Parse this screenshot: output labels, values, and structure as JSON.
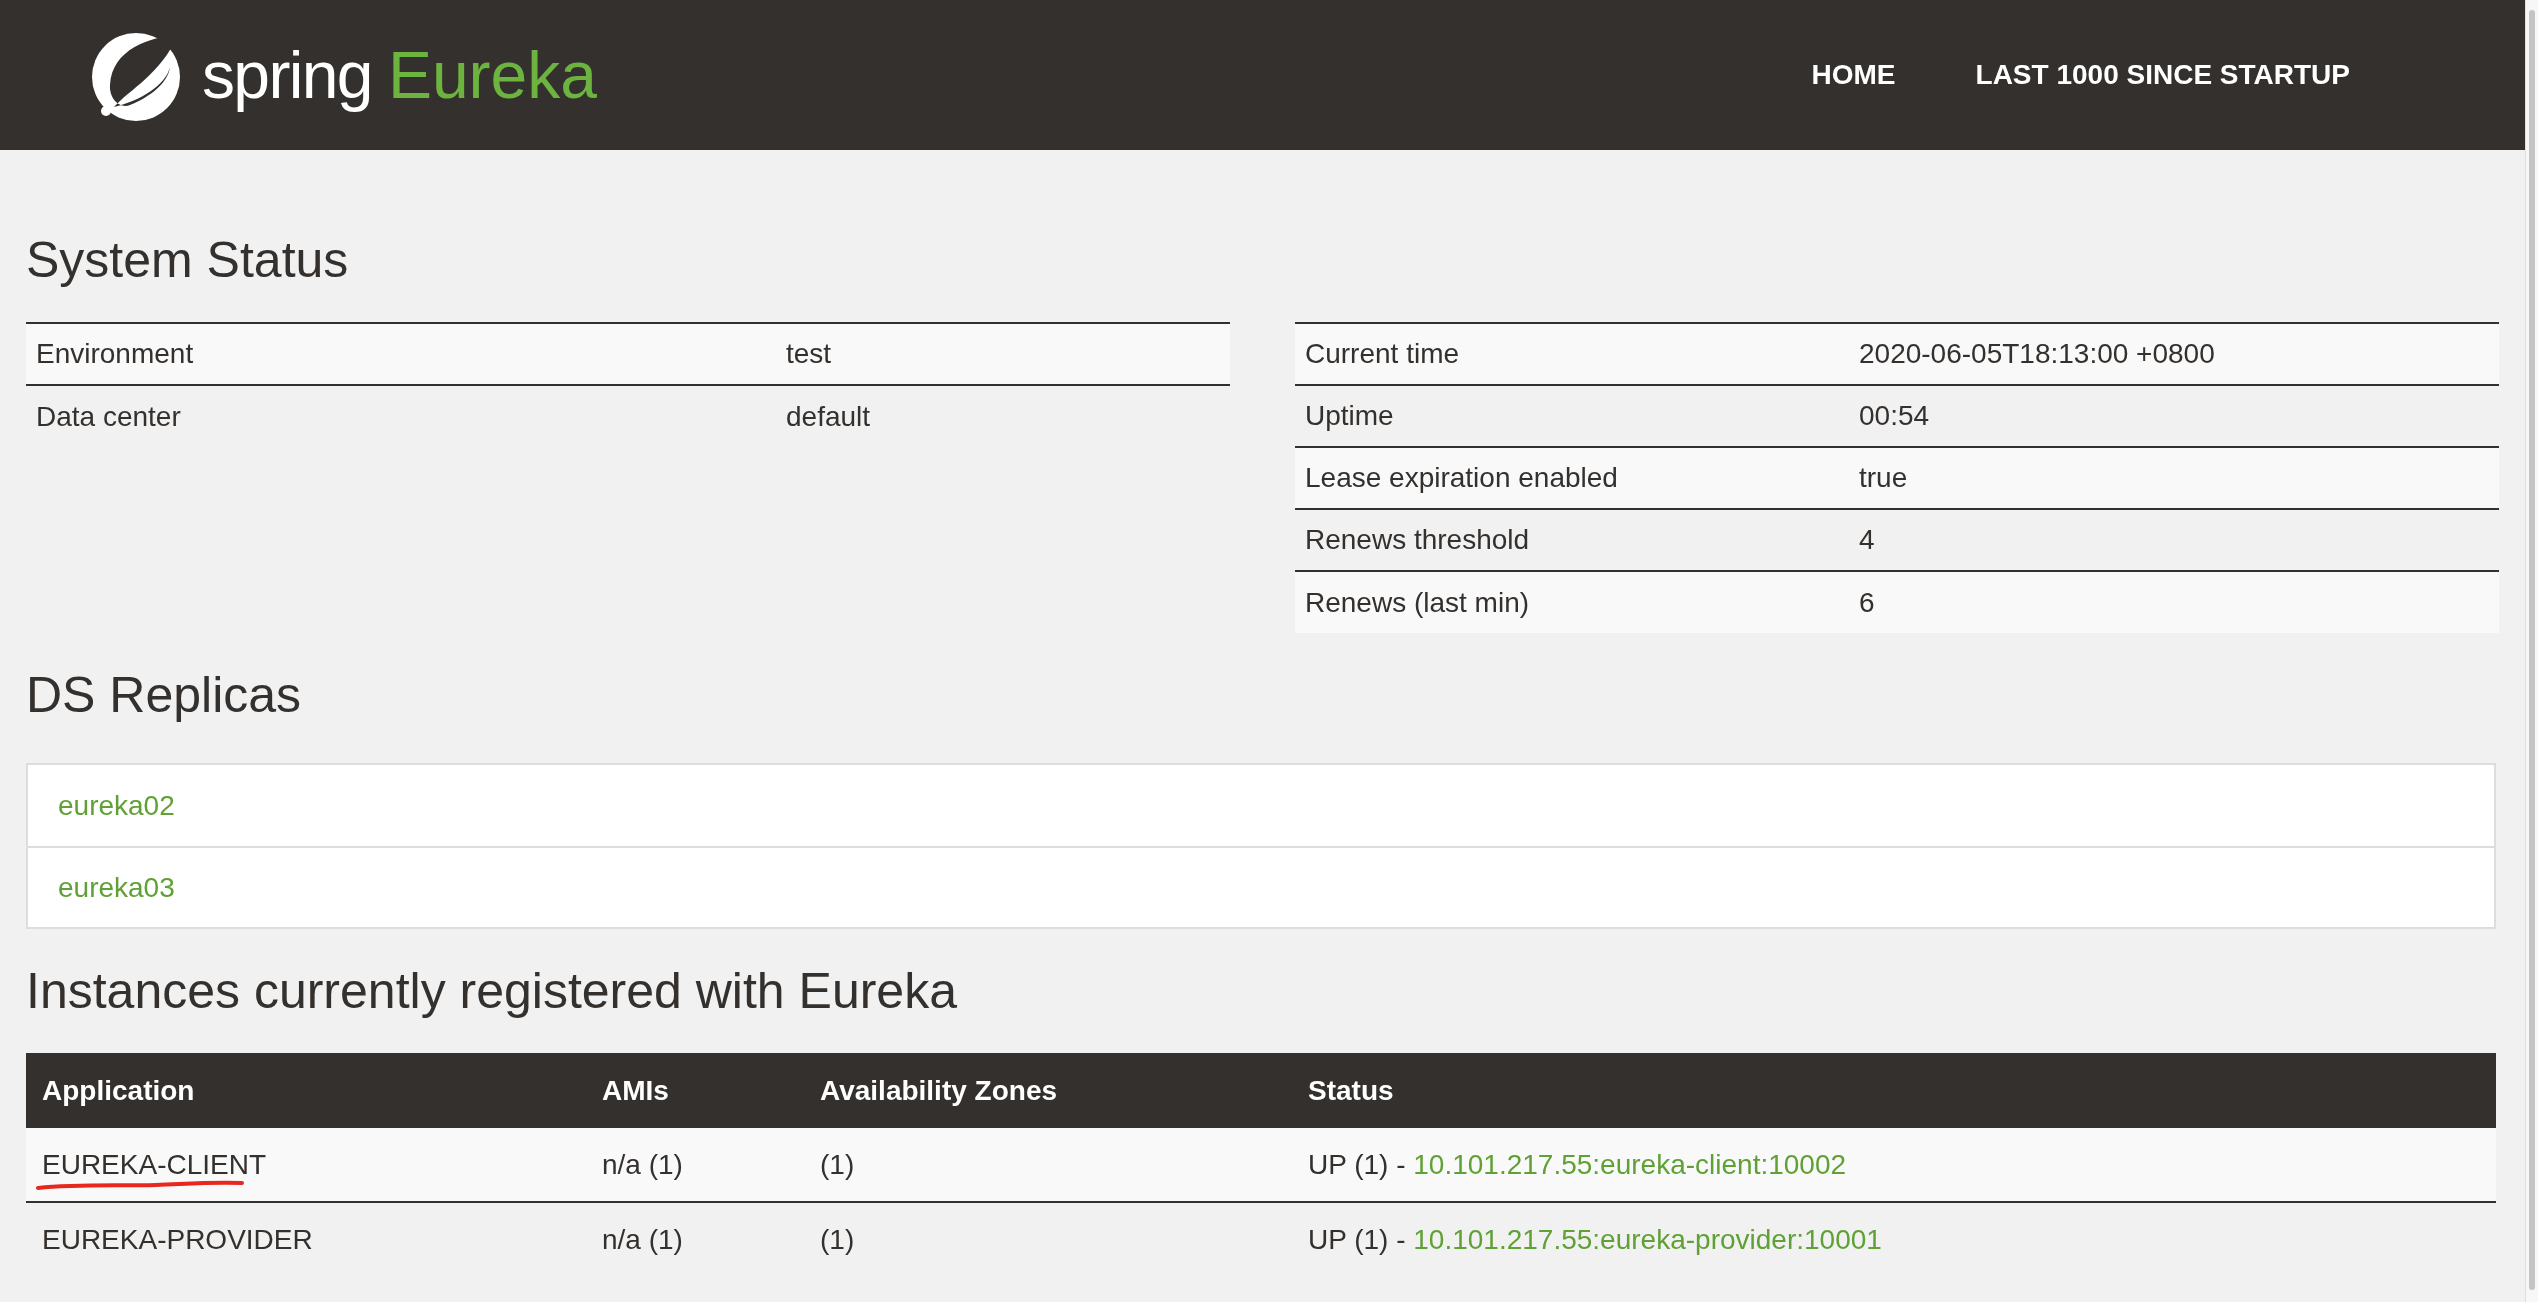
{
  "header": {
    "brand": {
      "word1": "spring",
      "word2": "Eureka"
    },
    "nav": [
      "HOME",
      "LAST 1000 SINCE STARTUP"
    ]
  },
  "system_status": {
    "title": "System Status",
    "left_table": [
      {
        "label": "Environment",
        "value": "test"
      },
      {
        "label": "Data center",
        "value": "default"
      }
    ],
    "right_table": [
      {
        "label": "Current time",
        "value": "2020-06-05T18:13:00 +0800"
      },
      {
        "label": "Uptime",
        "value": "00:54"
      },
      {
        "label": "Lease expiration enabled",
        "value": "true"
      },
      {
        "label": "Renews threshold",
        "value": "4"
      },
      {
        "label": "Renews (last min)",
        "value": "6"
      }
    ]
  },
  "ds_replicas": {
    "title": "DS Replicas",
    "items": [
      "eureka02",
      "eureka03"
    ]
  },
  "instances": {
    "title": "Instances currently registered with Eureka",
    "columns": [
      "Application",
      "AMIs",
      "Availability Zones",
      "Status"
    ],
    "rows": [
      {
        "application": "EUREKA-CLIENT",
        "amis": "n/a (1)",
        "zones": "(1)",
        "status": "UP (1) - ",
        "instance_link": "10.101.217.55:eureka-client:10002",
        "underlined": true
      },
      {
        "application": "EUREKA-PROVIDER",
        "amis": "n/a (1)",
        "zones": "(1)",
        "status": "UP (1) - ",
        "instance_link": "10.101.217.55:eureka-provider:10001",
        "underlined": false
      }
    ]
  }
}
